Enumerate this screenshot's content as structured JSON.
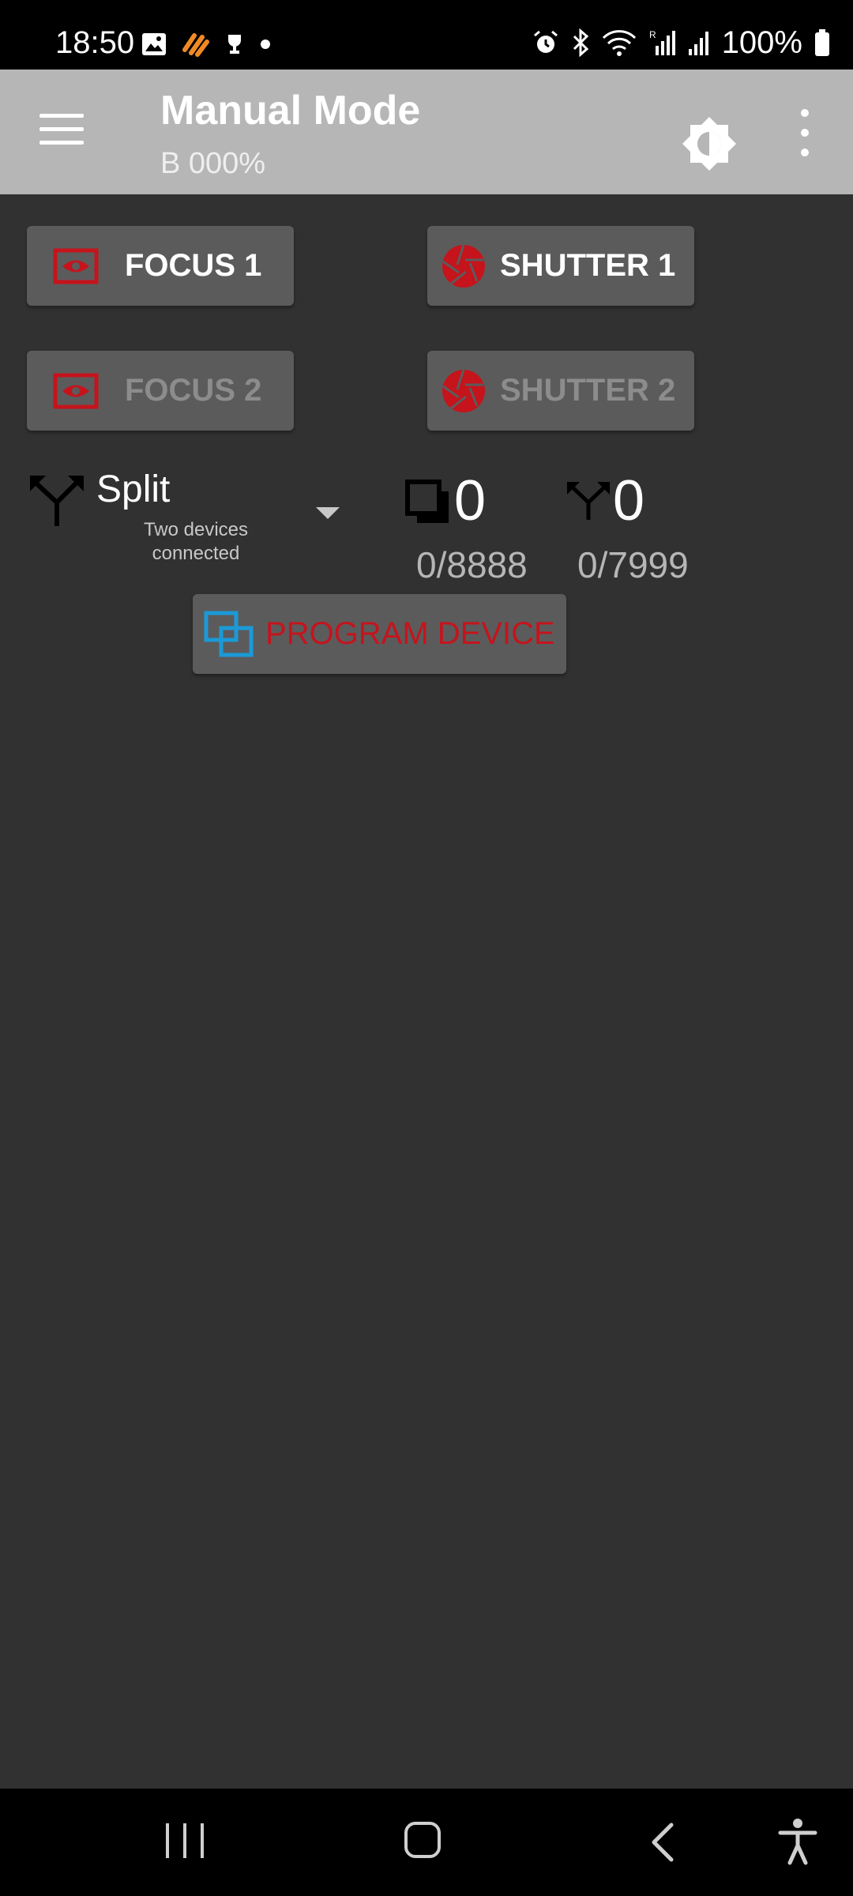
{
  "status_bar": {
    "time": "18:50",
    "battery": "100%",
    "left_icons": [
      "gallery-icon",
      "app-notification-icon",
      "trophy-icon",
      "dot-icon"
    ],
    "right_icons": [
      "alarm-icon",
      "bluetooth-icon",
      "wifi-icon",
      "signal-r-icon",
      "signal-icon",
      "battery-icon"
    ]
  },
  "app_bar": {
    "title": "Manual Mode",
    "subtitle": "B 000%",
    "icons": [
      "menu-icon",
      "brightness-icon",
      "more-vert-icon"
    ]
  },
  "buttons": {
    "focus1": "FOCUS 1",
    "shutter1": "SHUTTER 1",
    "focus2": "FOCUS 2",
    "shutter2": "SHUTTER 2",
    "program": "PROGRAM DEVICE"
  },
  "split": {
    "label": "Split",
    "sublabel": "Two devices connected"
  },
  "counters": {
    "frames": {
      "value": "0",
      "total": "0/8888"
    },
    "split": {
      "value": "0",
      "total": "0/7999"
    }
  },
  "colors": {
    "accent_red": "#c5141c",
    "accent_blue": "#1b9ad6",
    "background": "#323132",
    "app_bar": "#b6b6b6"
  }
}
